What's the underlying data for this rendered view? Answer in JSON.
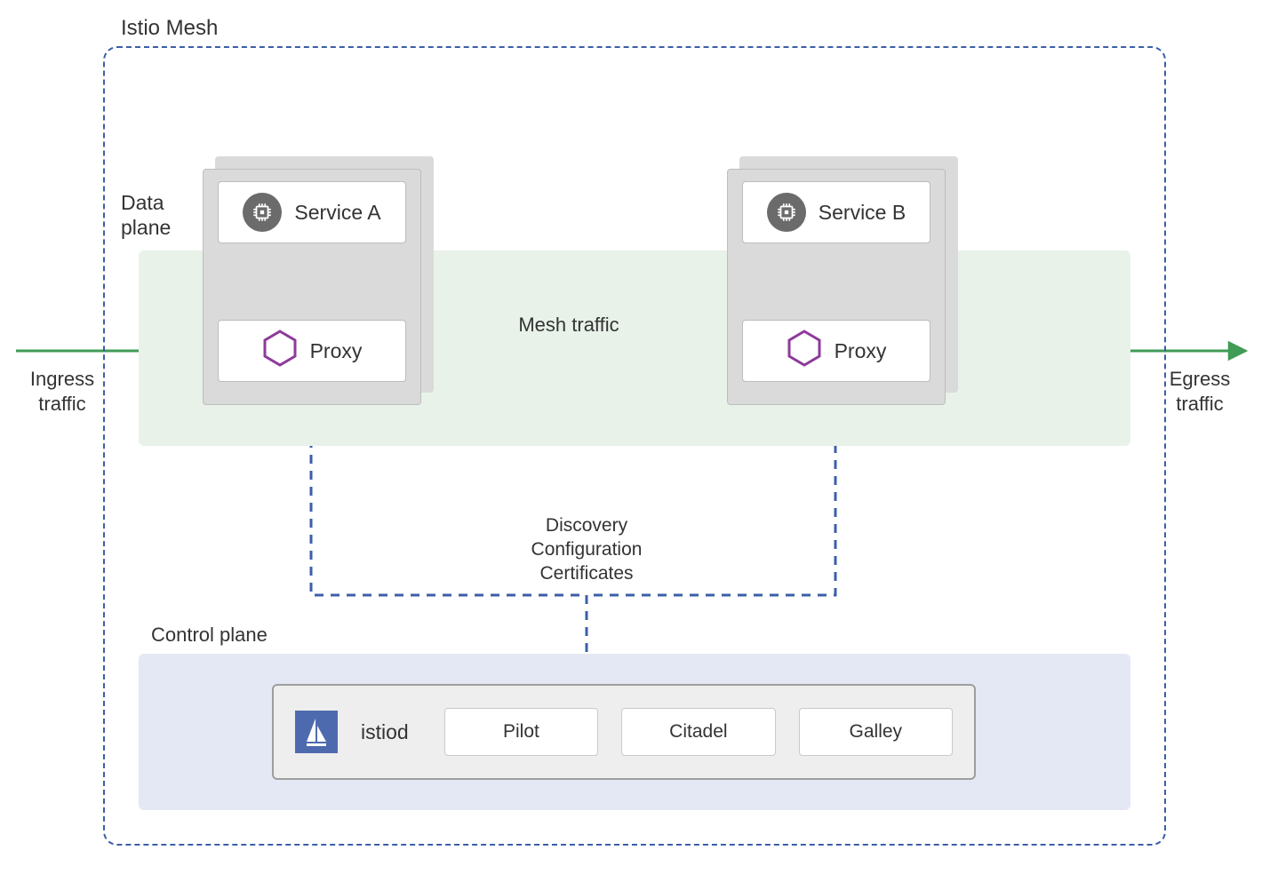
{
  "mesh": {
    "title": "Istio Mesh"
  },
  "data_plane": {
    "label_line1": "Data",
    "label_line2": "plane",
    "service_a": {
      "label": "Service A"
    },
    "service_b": {
      "label": "Service B"
    },
    "proxy_a": {
      "label": "Proxy"
    },
    "proxy_b": {
      "label": "Proxy"
    }
  },
  "traffic": {
    "ingress_line1": "Ingress",
    "ingress_line2": "traffic",
    "egress_line1": "Egress",
    "egress_line2": "traffic",
    "mesh_label": "Mesh traffic"
  },
  "pilot_link": {
    "line1": "Discovery",
    "line2": "Configuration",
    "line3": "Certificates"
  },
  "control_plane": {
    "label": "Control plane",
    "daemon": "istiod",
    "components": [
      "Pilot",
      "Citadel",
      "Galley"
    ]
  },
  "colors": {
    "mesh_border": "#3c5fa8",
    "traffic_arrow": "#3f9b55",
    "pilot_dash": "#3c5fa8",
    "proxy_hex": "#7b2d8e"
  }
}
